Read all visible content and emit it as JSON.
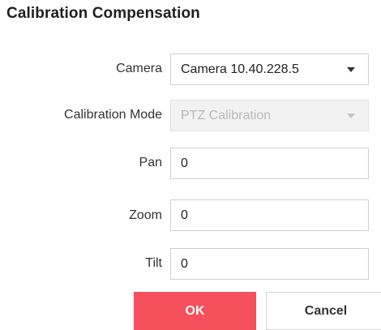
{
  "dialog": {
    "title": "Calibration Compensation"
  },
  "form": {
    "camera": {
      "label": "Camera",
      "value": "Camera 10.40.228.5"
    },
    "calibration_mode": {
      "label": "Calibration Mode",
      "value": "PTZ Calibration",
      "disabled": true
    },
    "pan": {
      "label": "Pan",
      "value": "0"
    },
    "zoom": {
      "label": "Zoom",
      "value": "0"
    },
    "tilt": {
      "label": "Tilt",
      "value": "0"
    }
  },
  "buttons": {
    "ok_label": "OK",
    "cancel_label": "Cancel"
  },
  "colors": {
    "primary": "#f5505c",
    "disabled_bg": "#f2f2f2"
  },
  "icons": {
    "dropdown": "chevron-down-icon"
  }
}
